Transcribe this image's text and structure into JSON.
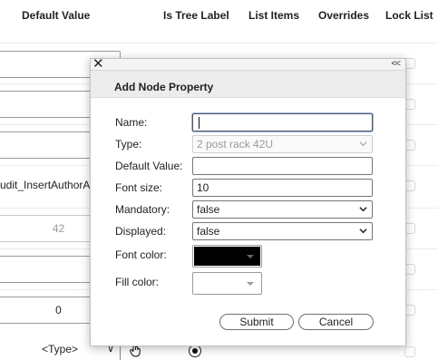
{
  "table": {
    "headers": [
      "Default Value",
      "Is Tree Label",
      "List Items",
      "Overrides",
      "Lock List"
    ],
    "rows": [
      {
        "value": ""
      },
      {
        "value": ""
      },
      {
        "value": ""
      },
      {
        "value": "udit_InsertAuthorAl"
      },
      {
        "value": "42"
      },
      {
        "value": ""
      },
      {
        "value": "0"
      }
    ],
    "type_select": "<Type>",
    "type_chevron": "∨"
  },
  "dialog": {
    "close_glyph": "✕",
    "collapse_glyph": "<<",
    "title": "Add Node Property",
    "fields": {
      "name": {
        "label": "Name:",
        "value": ""
      },
      "type": {
        "label": "Type:",
        "value": "2 post rack 42U"
      },
      "default_value": {
        "label": "Default Value:",
        "value": ""
      },
      "font_size": {
        "label": "Font size:",
        "value": "10"
      },
      "mandatory": {
        "label": "Mandatory:",
        "value": "false"
      },
      "displayed": {
        "label": "Displayed:",
        "value": "false"
      },
      "font_color": {
        "label": "Font color:",
        "color": "#000000"
      },
      "fill_color": {
        "label": "Fill color:",
        "color": "#ffffff"
      }
    },
    "buttons": {
      "submit": "Submit",
      "cancel": "Cancel"
    }
  },
  "colors": {
    "dialog_title_bg": "#ececec",
    "font_swatch": "#000000",
    "border": "#767676"
  }
}
